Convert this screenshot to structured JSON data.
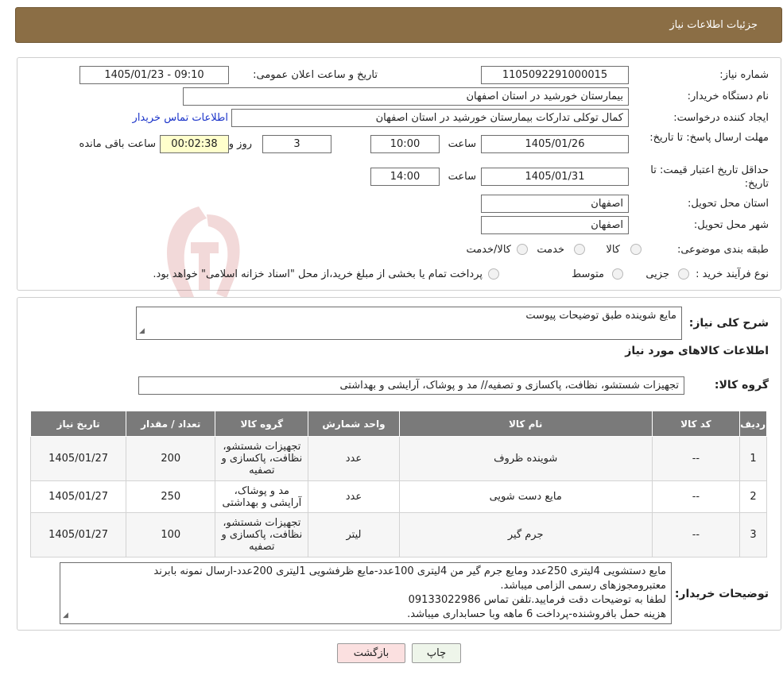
{
  "header": {
    "title": "جزئیات اطلاعات نیاز"
  },
  "form": {
    "need_number": {
      "label": "شماره نیاز:",
      "value": "1105092291000015"
    },
    "announce_datetime": {
      "label": "تاریخ و ساعت اعلان عمومی:",
      "value": "1405/01/23 - 09:10"
    },
    "buyer_org": {
      "label": "نام دستگاه خریدار:",
      "value": "بیمارستان خورشید در استان اصفهان"
    },
    "requester": {
      "label": "ایجاد کننده درخواست:",
      "value": "کمال توکلی تدارکات بیمارستان خورشید در استان اصفهان"
    },
    "contact_link": "اطلاعات تماس خریدار",
    "send_deadline": {
      "label": "مهلت ارسال پاسخ: تا تاریخ:",
      "date": "1405/01/26",
      "time_label": "ساعت",
      "time": "10:00",
      "days": "3",
      "days_label": "روز و",
      "remaining": "00:02:38",
      "remaining_label": "ساعت باقی مانده"
    },
    "price_validity": {
      "label": "حداقل تاریخ اعتبار قیمت: تا تاریخ:",
      "date": "1405/01/31",
      "time_label": "ساعت",
      "time": "14:00"
    },
    "delivery_province": {
      "label": "استان محل تحویل:",
      "value": "اصفهان"
    },
    "delivery_city": {
      "label": "شهر محل تحویل:",
      "value": "اصفهان"
    },
    "category": {
      "label": "طبقه بندی موضوعی:",
      "options": [
        "کالا",
        "خدمت",
        "کالا/خدمت"
      ]
    },
    "purchase_type": {
      "label": "نوع فرآیند خرید :",
      "options": [
        "جزیی",
        "متوسط"
      ],
      "note": "پرداخت تمام یا بخشی از مبلغ خرید،از محل \"اسناد خزانه اسلامی\" خواهد بود."
    }
  },
  "description": {
    "label": "شرح کلی نیاز:",
    "value": "مایع شوینده طبق توضیحات پیوست"
  },
  "items_section": {
    "title": "اطلاعات کالاهای مورد نیاز",
    "group_label": "گروه کالا:",
    "group_value": "تجهیزات شستشو، نظافت، پاکسازی و تصفیه// مد و پوشاک، آرایشی و بهداشتی"
  },
  "table": {
    "headers": [
      "ردیف",
      "کد کالا",
      "نام کالا",
      "واحد شمارش",
      "گروه کالا",
      "تعداد / مقدار",
      "تاریخ نیاز"
    ],
    "rows": [
      [
        "1",
        "--",
        "شوینده ظروف",
        "عدد",
        "تجهیزات شستشو، نظافت، پاکسازی و تصفیه",
        "200",
        "1405/01/27"
      ],
      [
        "2",
        "--",
        "مایع دست شویی",
        "عدد",
        "مد و پوشاک، آرایشی و بهداشتی",
        "250",
        "1405/01/27"
      ],
      [
        "3",
        "--",
        "جرم گیر",
        "لیتر",
        "تجهیزات شستشو، نظافت، پاکسازی و تصفیه",
        "100",
        "1405/01/27"
      ]
    ]
  },
  "buyer_notes": {
    "label": "توضیحات خریدار:",
    "lines": [
      "مایع دستشویی 4لیتری 250عدد ومایع جرم گیر من 4لیتری 100عدد-مایع ظرفشویی 1لیتری 200عدد-ارسال نمونه بابرند",
      "معتبرومجوزهای رسمی الزامی میباشد.",
      "لطفا به توضیحات دقت فرمایید.تلفن تماس 09133022986",
      "هزینه حمل بافروشنده-پرداخت 6 ماهه وبا حسابداری میباشد."
    ]
  },
  "buttons": {
    "print": "چاپ",
    "back": "بازگشت"
  },
  "colors": {
    "header_bg": "#8b6e45",
    "table_header_bg": "#7a7a7a",
    "link": "#1a33c9",
    "back_button_bg": "#fbe0e0"
  }
}
